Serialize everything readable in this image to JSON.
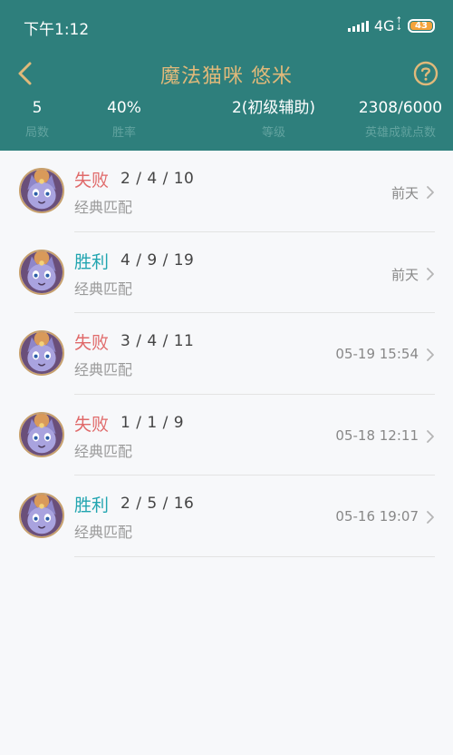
{
  "status_bar": {
    "time": "下午1:12",
    "network": "4G",
    "battery": "43"
  },
  "nav": {
    "title": "魔法猫咪 悠米",
    "back_icon": "back-chevron-icon",
    "help_icon": "help-circle-icon"
  },
  "stats": [
    {
      "value": "5",
      "label": "局数"
    },
    {
      "value": "40%",
      "label": "胜率"
    },
    {
      "value": "2(初级辅助)",
      "label": "等级"
    },
    {
      "value": "2308/6000",
      "label": "英雄成就点数"
    }
  ],
  "matches": [
    {
      "result": "失败",
      "outcome": "loss",
      "kda": "2 / 4 / 10",
      "mode": "经典匹配",
      "time": "前天"
    },
    {
      "result": "胜利",
      "outcome": "win",
      "kda": "4 / 9 / 19",
      "mode": "经典匹配",
      "time": "前天"
    },
    {
      "result": "失败",
      "outcome": "loss",
      "kda": "3 / 4 / 11",
      "mode": "经典匹配",
      "time": "05-19 15:54"
    },
    {
      "result": "失败",
      "outcome": "loss",
      "kda": "1 / 1 / 9",
      "mode": "经典匹配",
      "time": "05-18 12:11"
    },
    {
      "result": "胜利",
      "outcome": "win",
      "kda": "2 / 5 / 16",
      "mode": "经典匹配",
      "time": "05-16 19:07"
    }
  ],
  "colors": {
    "header_bg": "#2e7f7c",
    "title": "#e0b97a",
    "win": "#22a5b0",
    "loss": "#e06a6a"
  }
}
